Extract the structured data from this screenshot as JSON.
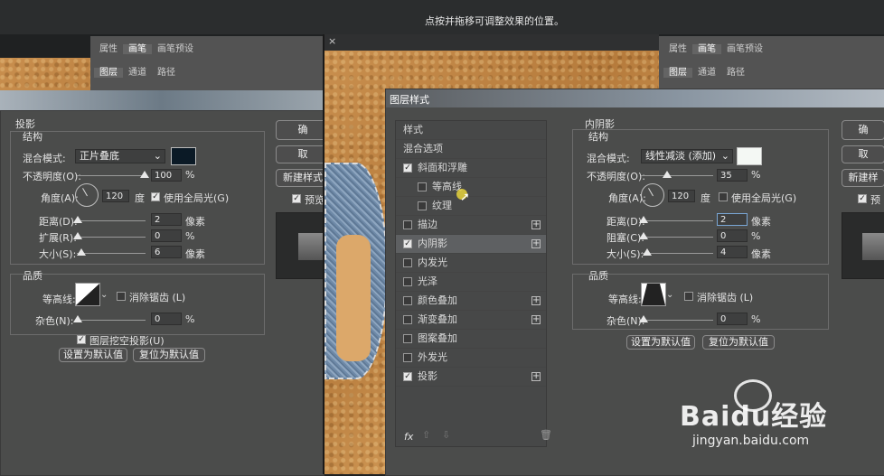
{
  "top_hint": "点按并拖移可调整效果的位置。",
  "panel_tabs_top": [
    "属性",
    "画笔",
    "画笔预设"
  ],
  "panel_tabs_bottom": [
    "图层",
    "通道",
    "路径"
  ],
  "left_dialog": {
    "section_title": "投影",
    "structure_title": "结构",
    "blend_label": "混合模式:",
    "blend_value": "正片叠底",
    "blend_color": "#0b1a26",
    "opacity_label": "不透明度(O):",
    "opacity_value": "100",
    "opacity_level": 1.0,
    "angle_label": "角度(A):",
    "angle_value": "120",
    "angle_unit": "度",
    "global_light_label": "使用全局光(G)",
    "distance_label": "距离(D):",
    "distance_value": "2",
    "spread_label": "扩展(R):",
    "spread_value": "0",
    "size_label": "大小(S):",
    "size_value": "6",
    "unit_px": "像素",
    "unit_pct": "%",
    "quality_title": "品质",
    "contour_label": "等高线:",
    "antialias_label": "消除锯齿 (L)",
    "noise_label": "杂色(N):",
    "noise_value": "0",
    "knockout_label": "图层挖空投影(U)",
    "make_default": "设置为默认值",
    "reset_default": "复位为默认值",
    "btn_ok": "确",
    "btn_cancel": "取",
    "btn_new_style": "新建样式",
    "preview_label": "预览"
  },
  "right_dialog": {
    "title": "图层样式",
    "styles_header": "样式",
    "blend_options": "混合选项",
    "effects": [
      {
        "label": "斜面和浮雕",
        "checked": true,
        "indent": false,
        "plus": false
      },
      {
        "label": "等高线",
        "checked": false,
        "indent": true,
        "plus": false
      },
      {
        "label": "纹理",
        "checked": false,
        "indent": true,
        "plus": false
      },
      {
        "label": "描边",
        "checked": false,
        "indent": false,
        "plus": true
      },
      {
        "label": "内阴影",
        "checked": true,
        "indent": false,
        "plus": true,
        "selected": true
      },
      {
        "label": "内发光",
        "checked": false,
        "indent": false,
        "plus": false
      },
      {
        "label": "光泽",
        "checked": false,
        "indent": false,
        "plus": false
      },
      {
        "label": "颜色叠加",
        "checked": false,
        "indent": false,
        "plus": true
      },
      {
        "label": "渐变叠加",
        "checked": false,
        "indent": false,
        "plus": true
      },
      {
        "label": "图案叠加",
        "checked": false,
        "indent": false,
        "plus": false
      },
      {
        "label": "外发光",
        "checked": false,
        "indent": false,
        "plus": false
      },
      {
        "label": "投影",
        "checked": true,
        "indent": false,
        "plus": true
      }
    ],
    "fx_label": "fx",
    "section_title": "内阴影",
    "structure_title": "结构",
    "blend_label": "混合模式:",
    "blend_value": "线性减淡 (添加)",
    "blend_color": "#f4f8f4",
    "opacity_label": "不透明度(O):",
    "opacity_value": "35",
    "opacity_level": 0.35,
    "angle_label": "角度(A):",
    "angle_value": "120",
    "angle_unit": "度",
    "global_light_label": "使用全局光(G)",
    "distance_label": "距离(D):",
    "distance_value": "2",
    "choke_label": "阻塞(C):",
    "choke_value": "0",
    "size_label": "大小(S):",
    "size_value": "4",
    "unit_px": "像素",
    "unit_pct": "%",
    "quality_title": "品质",
    "contour_label": "等高线:",
    "antialias_label": "消除锯齿 (L)",
    "noise_label": "杂色(N):",
    "noise_value": "0",
    "make_default": "设置为默认值",
    "reset_default": "复位为默认值",
    "btn_ok": "确",
    "btn_cancel": "取",
    "btn_new_style": "新建样",
    "preview_label": "预"
  },
  "watermark": {
    "brand": "Baidu经验",
    "url": "jingyan.baidu.com"
  }
}
